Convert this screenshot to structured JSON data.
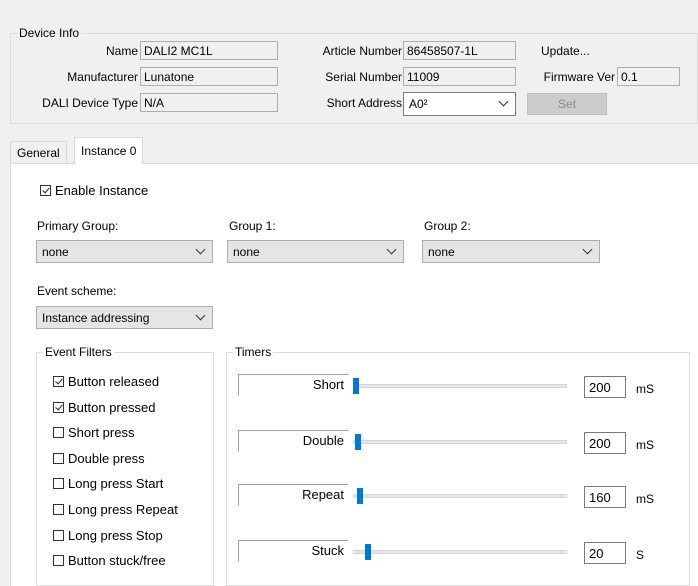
{
  "device_info": {
    "legend": "Device Info",
    "name_label": "Name",
    "name_value": "DALI2 MC1L",
    "manufacturer_label": "Manufacturer",
    "manufacturer_value": "Lunatone",
    "dali_type_label": "DALI Device Type",
    "dali_type_value": "N/A",
    "article_label": "Article Number",
    "article_value": "86458507-1L",
    "serial_label": "Serial Number",
    "serial_value": "11009",
    "short_address_label": "Short Address",
    "short_address_value": "A0²",
    "update_label": "Update...",
    "firmware_label": "Firmware Ver",
    "firmware_value": "0.1",
    "set_label": "Set"
  },
  "tabs": [
    {
      "label": "General"
    },
    {
      "label": "Instance 0"
    }
  ],
  "instance": {
    "enable_label": "Enable Instance",
    "enable_checked": true,
    "primary_group_label": "Primary Group:",
    "primary_group_value": "none",
    "group1_label": "Group 1:",
    "group1_value": "none",
    "group2_label": "Group 2:",
    "group2_value": "none",
    "event_scheme_label": "Event scheme:",
    "event_scheme_value": "Instance addressing"
  },
  "event_filters": {
    "legend": "Event Filters",
    "items": [
      {
        "label": "Button released",
        "checked": true
      },
      {
        "label": "Button pressed",
        "checked": true
      },
      {
        "label": "Short press",
        "checked": false
      },
      {
        "label": "Double press",
        "checked": false
      },
      {
        "label": "Long press Start",
        "checked": false
      },
      {
        "label": "Long press Repeat",
        "checked": false
      },
      {
        "label": "Long press Stop",
        "checked": false
      },
      {
        "label": "Button stuck/free",
        "checked": false
      }
    ]
  },
  "timers": {
    "legend": "Timers",
    "items": [
      {
        "label": "Short",
        "value": "200",
        "unit": "mS",
        "slider_fraction": 0.0
      },
      {
        "label": "Double",
        "value": "200",
        "unit": "mS",
        "slider_fraction": 0.01
      },
      {
        "label": "Repeat",
        "value": "160",
        "unit": "mS",
        "slider_fraction": 0.02
      },
      {
        "label": "Stuck",
        "value": "20",
        "unit": "S",
        "slider_fraction": 0.06
      }
    ]
  },
  "colors": {
    "accent": "#0078d7",
    "window_bg": "#f0f0f0",
    "panel_bg": "#ffffff"
  }
}
